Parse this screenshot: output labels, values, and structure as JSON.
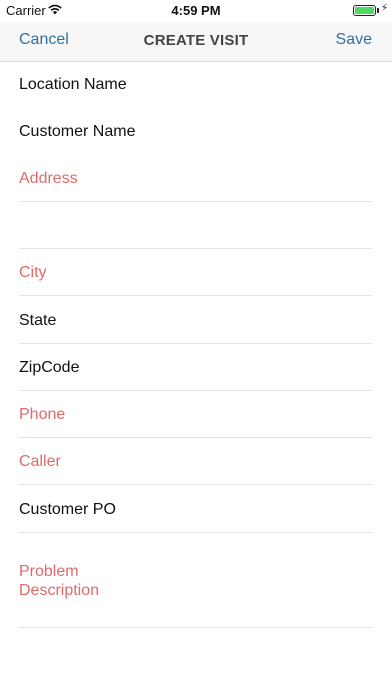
{
  "status_bar": {
    "carrier": "Carrier",
    "time": "4:59 PM",
    "wifi_icon": "wifi-icon",
    "battery_icon": "battery-icon",
    "charging_icon": "charging-bolt-icon"
  },
  "nav": {
    "cancel_label": "Cancel",
    "title": "CREATE VISIT",
    "save_label": "Save",
    "accent_color": "#2f6fa4"
  },
  "form": {
    "required_color": "#e06a6a",
    "fields": [
      {
        "placeholder": "Location Name"
      },
      {
        "placeholder": "Customer Name"
      },
      {
        "placeholder": "Address"
      },
      {
        "placeholder": ""
      },
      {
        "placeholder": "City"
      },
      {
        "placeholder": "State"
      },
      {
        "placeholder": "ZipCode"
      },
      {
        "placeholder": "Phone"
      },
      {
        "placeholder": "Caller"
      },
      {
        "placeholder": "Customer PO"
      },
      {
        "placeholder": "Problem Description"
      }
    ]
  }
}
